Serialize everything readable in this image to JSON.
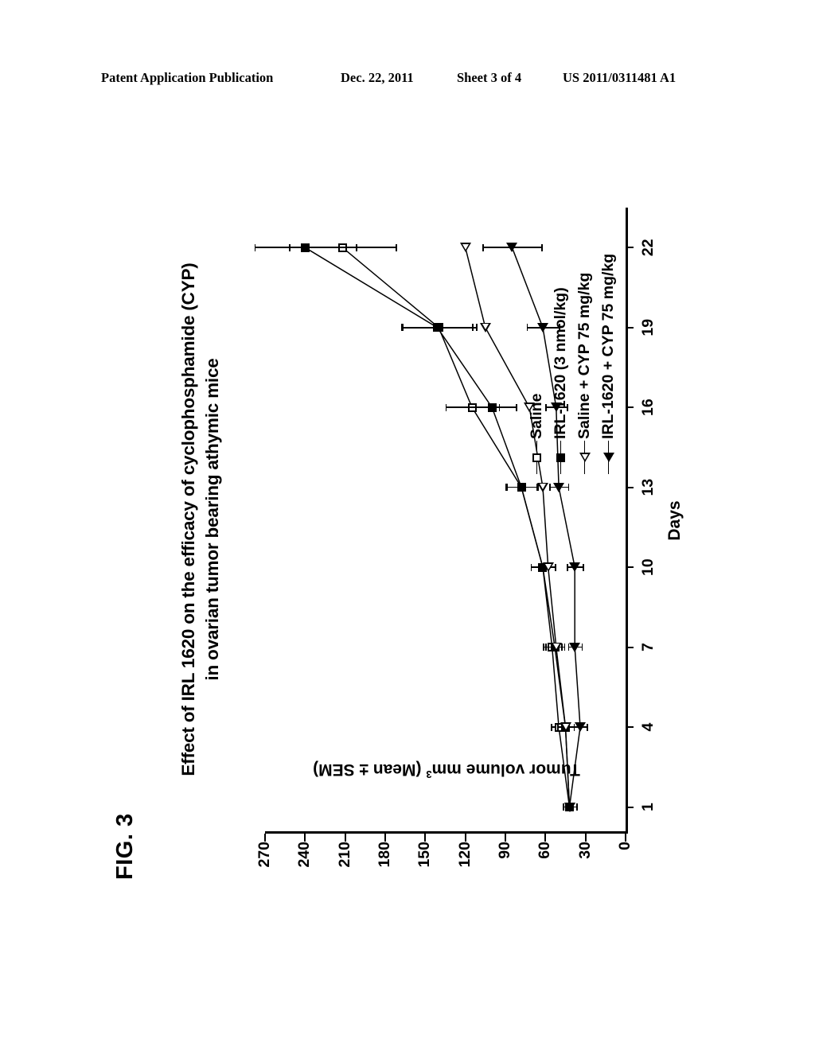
{
  "header": {
    "publication": "Patent Application Publication",
    "date": "Dec. 22, 2011",
    "sheet": "Sheet 3 of 4",
    "number": "US 2011/0311481 A1"
  },
  "figure": {
    "label": "FIG. 3"
  },
  "chart_data": {
    "type": "line",
    "title": "Effect of IRL 1620 on the efficacy of cyclophosphamide (CYP) in ovarian tumor bearing athymic mice",
    "title_line1": "Effect of IRL 1620 on the efficacy of cyclophosphamide (CYP)",
    "title_line2": "in ovarian tumor bearing athymic mice",
    "xlabel": "Days",
    "ylabel": "Tumor volume mm3 (Mean ± SEM)",
    "ylabel_pre": "Tumor volume mm",
    "ylabel_sup": "3",
    "ylabel_post": " (Mean ± SEM)",
    "x": [
      1,
      4,
      7,
      10,
      13,
      16,
      19,
      22
    ],
    "xticklabels": [
      "1",
      "4",
      "7",
      "10",
      "13",
      "16",
      "19",
      "22"
    ],
    "xlim": [
      0,
      23.5
    ],
    "yticklabels": [
      "270",
      "240",
      "210",
      "180",
      "150",
      "120",
      "90",
      "60",
      "30",
      "0"
    ],
    "yticks": [
      270,
      240,
      210,
      180,
      150,
      120,
      90,
      60,
      30,
      0
    ],
    "ylim": [
      0,
      270
    ],
    "grid": false,
    "legend_position": "upper-left-inside",
    "series": [
      {
        "name": "Saline",
        "marker": "open-square",
        "values": [
          42,
          50,
          55,
          62,
          78,
          115,
          140,
          212
        ],
        "errors": [
          5,
          6,
          7,
          9,
          12,
          20,
          28,
          40
        ]
      },
      {
        "name": "IRL-1620 (3 nmol/kg)",
        "marker": "filled-square",
        "values": [
          42,
          45,
          53,
          62,
          78,
          100,
          141,
          240
        ],
        "errors": [
          5,
          6,
          7,
          9,
          11,
          18,
          26,
          38
        ]
      },
      {
        "name": "Saline + CYP 75 mg/kg",
        "marker": "open-triangle",
        "values": [
          42,
          45,
          52,
          58,
          62,
          72,
          105,
          120
        ]
      },
      {
        "name": "IRL-1620 + CYP 75 mg/kg",
        "marker": "filled-triangle",
        "values": [
          42,
          34,
          38,
          38,
          50,
          52,
          62,
          85
        ],
        "errors": [
          5,
          5,
          5,
          6,
          7,
          8,
          12,
          22
        ]
      }
    ]
  }
}
